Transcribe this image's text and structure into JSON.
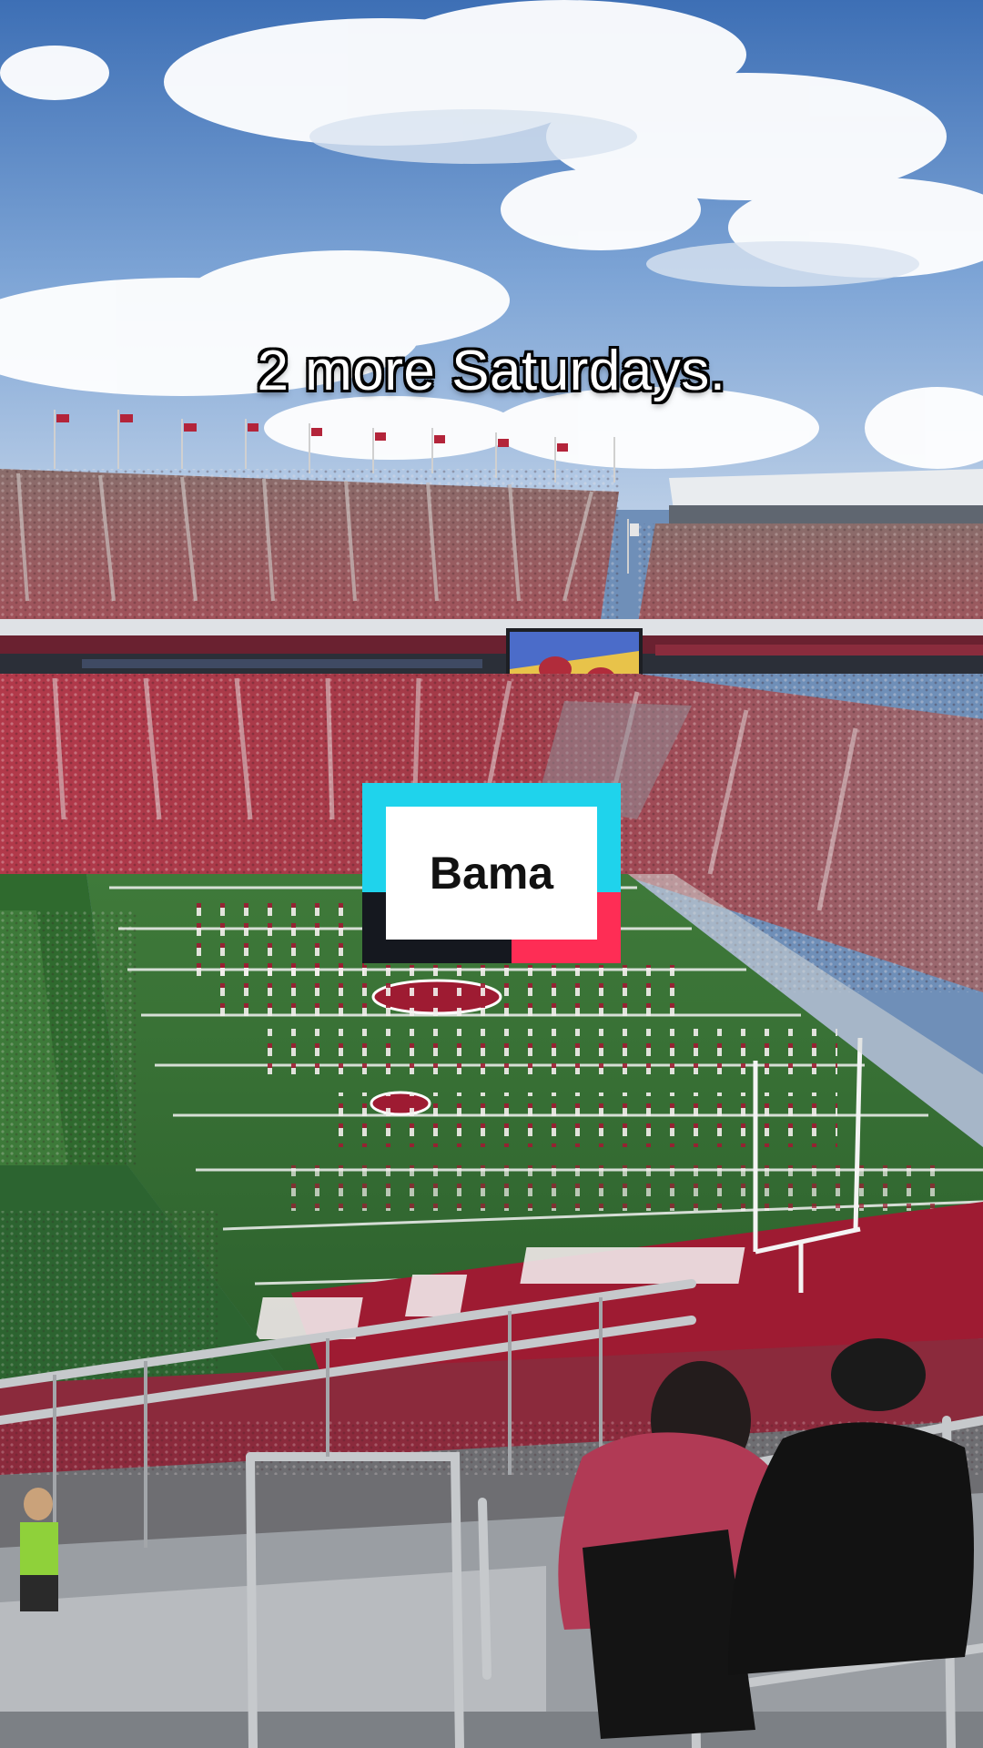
{
  "caption": "2 more Saturdays.",
  "sticker": {
    "label": "Bama",
    "colors": {
      "cyan": "#1fd3ec",
      "dark": "#15181f",
      "pink": "#fe2d55",
      "card": "#ffffff"
    }
  },
  "scene": {
    "description_colors": {
      "sky": "#6f9ad0",
      "field_green": "#2f6b34",
      "endzone_crimson": "#9e1b32",
      "crowd_crimson": "#a8323f"
    }
  }
}
